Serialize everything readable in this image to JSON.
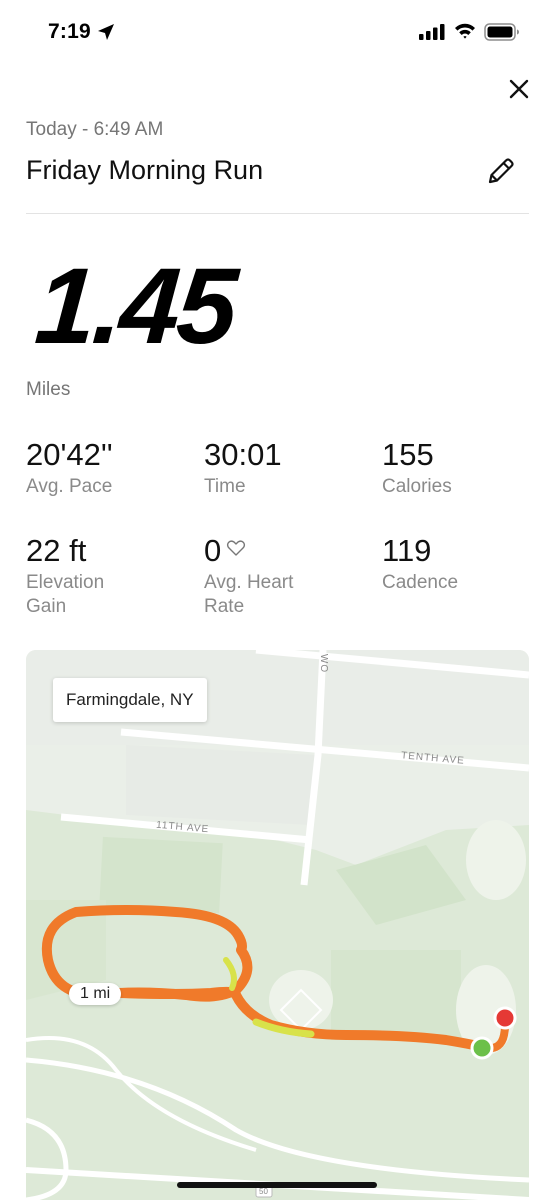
{
  "status_bar": {
    "time": "7:19",
    "icons": [
      "location-arrow-icon",
      "cellular-signal-icon",
      "wifi-icon",
      "battery-icon"
    ]
  },
  "header": {
    "date_line": "Today - 6:49 AM",
    "title": "Friday Morning Run",
    "close_icon": "close-icon",
    "edit_icon": "pencil-icon"
  },
  "distance": {
    "value": "1.45",
    "unit": "Miles"
  },
  "stats": {
    "avg_pace": {
      "value": "20'42''",
      "label": "Avg. Pace"
    },
    "time": {
      "value": "30:01",
      "label": "Time"
    },
    "calories": {
      "value": "155",
      "label": "Calories"
    },
    "elevation": {
      "value": "22 ft",
      "label_line1": "Elevation",
      "label_line2": "Gain"
    },
    "heart_rate": {
      "value": "0",
      "label_line1": "Avg. Heart",
      "label_line2": "Rate",
      "icon": "heart-icon"
    },
    "cadence": {
      "value": "119",
      "label": "Cadence"
    }
  },
  "map": {
    "location": "Farmingdale, NY",
    "mile_marker": "1 mi",
    "road_labels": {
      "tenth_ave": "TENTH AVE",
      "eleventh_ave": "11TH AVE",
      "vertical_road": "WO",
      "bottom_shield": "50"
    },
    "colors": {
      "route_main": "#f07a2a",
      "route_fast": "#d8e24a",
      "start_marker": "#6cc04a",
      "end_marker": "#e53935"
    }
  }
}
